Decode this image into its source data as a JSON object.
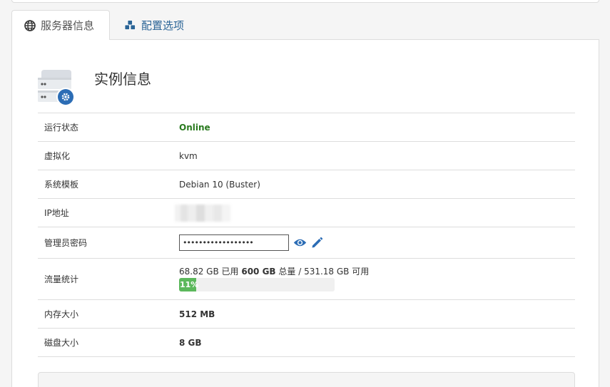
{
  "tabs": {
    "server_info": "服务器信息",
    "config": "配置选项"
  },
  "instance": {
    "title": "实例信息"
  },
  "rows": {
    "status": {
      "label": "运行状态",
      "value": "Online"
    },
    "virtualization": {
      "label": "虚拟化",
      "value": "kvm"
    },
    "template": {
      "label": "系统模板",
      "value": "Debian 10 (Buster)"
    },
    "ip": {
      "label": "IP地址"
    },
    "password": {
      "label": "管理员密码",
      "value": "••••••••••••••••••"
    },
    "traffic": {
      "label": "流量统计",
      "used": "68.82 GB",
      "used_suffix": " 已用 ",
      "total": "600 GB",
      "total_suffix": " 总量 / ",
      "available": "531.18 GB",
      "available_suffix": " 可用",
      "percent_label": "11%",
      "percent": 11
    },
    "memory": {
      "label": "内存大小",
      "value": "512 MB"
    },
    "disk": {
      "label": "磁盘大小",
      "value": "8 GB"
    }
  },
  "colors": {
    "link": "#2a6496",
    "online": "#2a7a1f",
    "progress": "#5cb85c",
    "icon_blue": "#2c6db5"
  },
  "icons": {
    "server_info_tab": "globe-icon",
    "config_tab": "cubes-icon",
    "server": "server-gear-icon",
    "show_password": "eye-icon",
    "edit_password": "pencil-icon"
  }
}
